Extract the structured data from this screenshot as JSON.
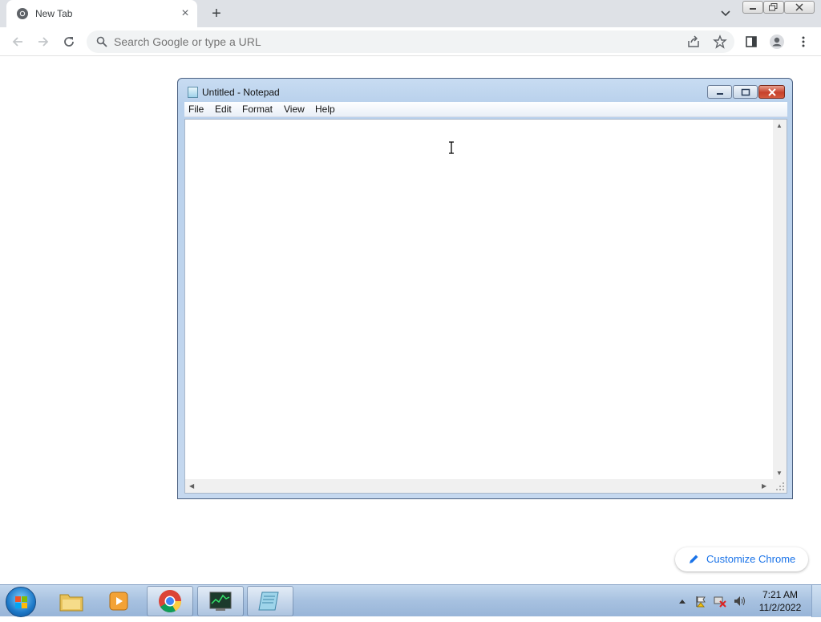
{
  "browser": {
    "tab_title": "New Tab",
    "tab_close": "×",
    "new_tab_label": "+",
    "omnibox_placeholder": "Search Google or type a URL",
    "customize_label": "Customize Chrome",
    "accent_color": "#1a73e8"
  },
  "notepad": {
    "title": "Untitled - Notepad",
    "menu": [
      "File",
      "Edit",
      "Format",
      "View",
      "Help"
    ],
    "content": ""
  },
  "taskbar": {
    "apps": [
      "file-explorer",
      "media-player",
      "chrome",
      "task-manager",
      "notepad"
    ],
    "clock_time": "7:21 AM",
    "clock_date": "11/2/2022"
  }
}
